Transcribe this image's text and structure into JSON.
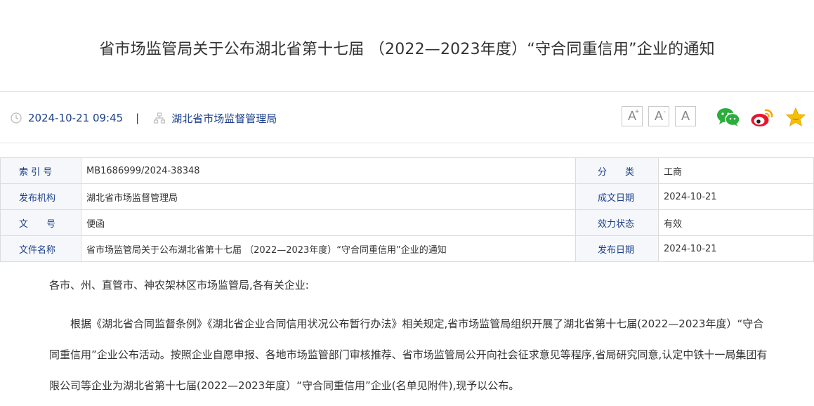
{
  "article": {
    "title": "省市场监管局关于公布湖北省第十七届 （2022—2023年度）“守合同重信用”企业的通知"
  },
  "meta": {
    "datetime": "2024-10-21 09:45",
    "separator": "|",
    "publisher": "湖北省市场监督管理局",
    "clock_icon": "clock-icon",
    "org_icon": "org-chart-icon"
  },
  "font_controls": {
    "increase": "A",
    "increase_sup": "+",
    "decrease": "A",
    "decrease_sup": "-",
    "reset": "A"
  },
  "share": {
    "icons": [
      "wechat-icon",
      "weibo-icon",
      "favorite-star-icon"
    ],
    "colors": {
      "wechat": "#2aae3b",
      "weibo": "#e6162d",
      "star": "#f5a800"
    }
  },
  "info_table": {
    "rows": [
      {
        "label": "索 引 号",
        "value": "MB1686999/2024-38348",
        "label2": "分　　类",
        "value2": "工商"
      },
      {
        "label": "发布机构",
        "value": "湖北省市场监督管理局",
        "label2": "成文日期",
        "value2": "2024-10-21"
      },
      {
        "label": "文　　号",
        "value": "便函",
        "label2": "效力状态",
        "value2": "有效"
      },
      {
        "label": "文件名称",
        "value": "省市场监管局关于公布湖北省第十七届 （2022—2023年度）“守合同重信用”企业的通知",
        "label2": "发布日期",
        "value2": "2024-10-21"
      }
    ]
  },
  "content": {
    "greeting": "各市、州、直管市、神农架林区市场监管局,各有关企业:",
    "paragraph": "根据《湖北省合同监督条例》《湖北省企业合同信用状况公布暂行办法》相关规定,省市场监管局组织开展了湖北省第十七届(2022—2023年度）“守合同重信用”企业公布活动。按照企业自愿申报、各地市场监管部门审核推荐、省市场监管局公开向社会征求意见等程序,省局研究同意,认定中铁十一局集团有限公司等企业为湖北省第十七届(2022—2023年度）“守合同重信用”企业(名单见附件),现予以公布。"
  },
  "theme": {
    "accent": "#1b3f8b",
    "label_bg": "#f5f7fa",
    "border": "#dcdcdc"
  }
}
